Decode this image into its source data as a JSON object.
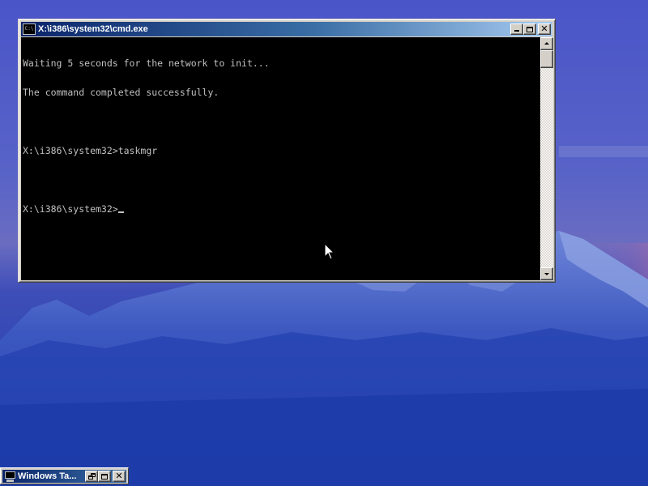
{
  "window": {
    "title": "X:\\i386\\system32\\cmd.exe",
    "icon_label": "C:\\",
    "icon": "console-icon",
    "buttons": {
      "minimize": "minimize-icon",
      "maximize": "maximize-icon",
      "close": "close-icon"
    }
  },
  "console": {
    "lines": [
      "Waiting 5 seconds for the network to init...",
      "The command completed successfully.",
      "",
      "X:\\i386\\system32>taskmgr",
      "",
      "X:\\i386\\system32>"
    ],
    "text_color": "#c0c0c0",
    "background_color": "#000000"
  },
  "minimized_window": {
    "title": "Windows Ta...",
    "icon": "monitor-icon",
    "buttons": {
      "restore": "restore-icon",
      "maximize": "maximize-icon",
      "close": "close-icon"
    }
  },
  "colors": {
    "titlebar_start": "#0a246a",
    "titlebar_end": "#a6caf0",
    "window_face": "#d4d0c8",
    "desktop_sky": "#3a4ab8"
  }
}
